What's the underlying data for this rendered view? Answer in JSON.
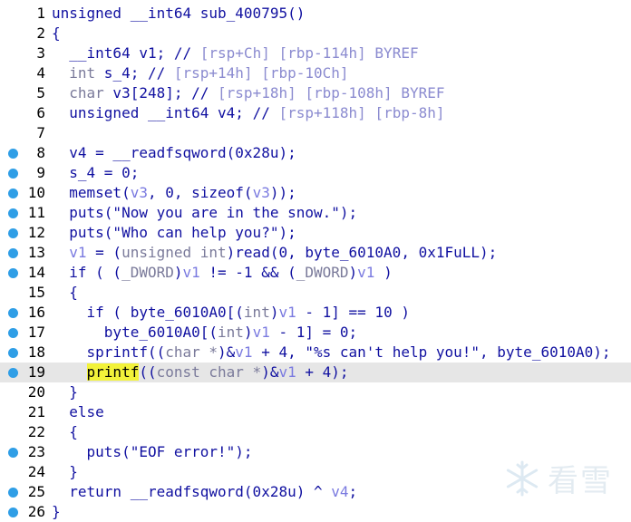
{
  "lines": [
    {
      "n": "1",
      "dot": false,
      "hl": false,
      "segs": [
        [
          "tk",
          "unsigned __int64 sub_400795()"
        ]
      ]
    },
    {
      "n": "2",
      "dot": false,
      "hl": false,
      "segs": [
        [
          "tk",
          "{"
        ]
      ]
    },
    {
      "n": "3",
      "dot": false,
      "hl": false,
      "segs": [
        [
          "tk",
          "  __int64 v1; "
        ],
        [
          "cm",
          "// "
        ],
        [
          "cmv",
          "[rsp+Ch] [rbp-114h] BYREF"
        ]
      ]
    },
    {
      "n": "4",
      "dot": false,
      "hl": false,
      "segs": [
        [
          "ty",
          "  int"
        ],
        [
          "tk",
          " s_4; "
        ],
        [
          "cm",
          "// "
        ],
        [
          "cmv",
          "[rsp+14h] [rbp-10Ch]"
        ]
      ]
    },
    {
      "n": "5",
      "dot": false,
      "hl": false,
      "segs": [
        [
          "ty",
          "  char"
        ],
        [
          "tk",
          " v3[248]; "
        ],
        [
          "cm",
          "// "
        ],
        [
          "cmv",
          "[rsp+18h] [rbp-108h] BYREF"
        ]
      ]
    },
    {
      "n": "6",
      "dot": false,
      "hl": false,
      "segs": [
        [
          "tk",
          "  unsigned __int64 v4; "
        ],
        [
          "cm",
          "// "
        ],
        [
          "cmv",
          "[rsp+118h] [rbp-8h]"
        ]
      ]
    },
    {
      "n": "7",
      "dot": false,
      "hl": false,
      "segs": []
    },
    {
      "n": "8",
      "dot": true,
      "hl": false,
      "segs": [
        [
          "tk",
          "  v4 = __readfsqword(0x28u);"
        ]
      ]
    },
    {
      "n": "9",
      "dot": true,
      "hl": false,
      "segs": [
        [
          "tk",
          "  s_4 = 0;"
        ]
      ]
    },
    {
      "n": "10",
      "dot": true,
      "hl": false,
      "segs": [
        [
          "tk",
          "  memset("
        ],
        [
          "var",
          "v3"
        ],
        [
          "tk",
          ", 0, sizeof("
        ],
        [
          "var",
          "v3"
        ],
        [
          "tk",
          "));"
        ]
      ]
    },
    {
      "n": "11",
      "dot": true,
      "hl": false,
      "segs": [
        [
          "tk",
          "  puts(\"Now you are in the snow.\");"
        ]
      ]
    },
    {
      "n": "12",
      "dot": true,
      "hl": false,
      "segs": [
        [
          "tk",
          "  puts(\"Who can help you?\");"
        ]
      ]
    },
    {
      "n": "13",
      "dot": true,
      "hl": false,
      "segs": [
        [
          "tk",
          "  "
        ],
        [
          "var",
          "v1"
        ],
        [
          "tk",
          " = ("
        ],
        [
          "ty",
          "unsigned int"
        ],
        [
          "tk",
          ")read(0, byte_6010A0, 0x1FuLL);"
        ]
      ]
    },
    {
      "n": "14",
      "dot": true,
      "hl": false,
      "segs": [
        [
          "tk",
          "  if ( ("
        ],
        [
          "ty",
          "_DWORD"
        ],
        [
          "tk",
          ")"
        ],
        [
          "var",
          "v1"
        ],
        [
          "tk",
          " != -1 && ("
        ],
        [
          "ty",
          "_DWORD"
        ],
        [
          "tk",
          ")"
        ],
        [
          "var",
          "v1"
        ],
        [
          "tk",
          " )"
        ]
      ]
    },
    {
      "n": "15",
      "dot": false,
      "hl": false,
      "segs": [
        [
          "tk",
          "  {"
        ]
      ]
    },
    {
      "n": "16",
      "dot": true,
      "hl": false,
      "segs": [
        [
          "tk",
          "    if ( byte_6010A0[("
        ],
        [
          "ty",
          "int"
        ],
        [
          "tk",
          ")"
        ],
        [
          "var",
          "v1"
        ],
        [
          "tk",
          " - 1] == 10 )"
        ]
      ]
    },
    {
      "n": "17",
      "dot": true,
      "hl": false,
      "segs": [
        [
          "tk",
          "      byte_6010A0[("
        ],
        [
          "ty",
          "int"
        ],
        [
          "tk",
          ")"
        ],
        [
          "var",
          "v1"
        ],
        [
          "tk",
          " - 1] = 0;"
        ]
      ]
    },
    {
      "n": "18",
      "dot": true,
      "hl": false,
      "segs": [
        [
          "tk",
          "    sprintf(("
        ],
        [
          "ty",
          "char *"
        ],
        [
          "tk",
          ")&"
        ],
        [
          "var",
          "v1"
        ],
        [
          "tk",
          " + 4, \"%s can't help you!\", byte_6010A0);"
        ]
      ]
    },
    {
      "n": "19",
      "dot": true,
      "hl": true,
      "segs": [
        [
          "tk",
          "    "
        ],
        [
          "hlw",
          "printf"
        ],
        [
          "tk",
          "(("
        ],
        [
          "ty",
          "const char *"
        ],
        [
          "tk",
          ")&"
        ],
        [
          "var",
          "v1"
        ],
        [
          "tk",
          " + 4);"
        ]
      ]
    },
    {
      "n": "20",
      "dot": false,
      "hl": false,
      "segs": [
        [
          "tk",
          "  }"
        ]
      ]
    },
    {
      "n": "21",
      "dot": false,
      "hl": false,
      "segs": [
        [
          "tk",
          "  else"
        ]
      ]
    },
    {
      "n": "22",
      "dot": false,
      "hl": false,
      "segs": [
        [
          "tk",
          "  {"
        ]
      ]
    },
    {
      "n": "23",
      "dot": true,
      "hl": false,
      "segs": [
        [
          "tk",
          "    puts(\"EOF error!\");"
        ]
      ]
    },
    {
      "n": "24",
      "dot": false,
      "hl": false,
      "segs": [
        [
          "tk",
          "  }"
        ]
      ]
    },
    {
      "n": "25",
      "dot": true,
      "hl": false,
      "segs": [
        [
          "tk",
          "  return __readfsqword(0x28u) ^ "
        ],
        [
          "var",
          "v4"
        ],
        [
          "tk",
          ";"
        ]
      ]
    },
    {
      "n": "26",
      "dot": true,
      "hl": false,
      "segs": [
        [
          "tk",
          "}"
        ]
      ]
    }
  ],
  "watermark": {
    "text": "看雪",
    "icon": "snowflake-icon"
  },
  "colors": {
    "keyword": "#1010a0",
    "comment": "#8b8bd0",
    "variable": "#7a7ae0",
    "highlight": "#f2f23a",
    "breakpoint_dot": "#2f9ee6"
  }
}
